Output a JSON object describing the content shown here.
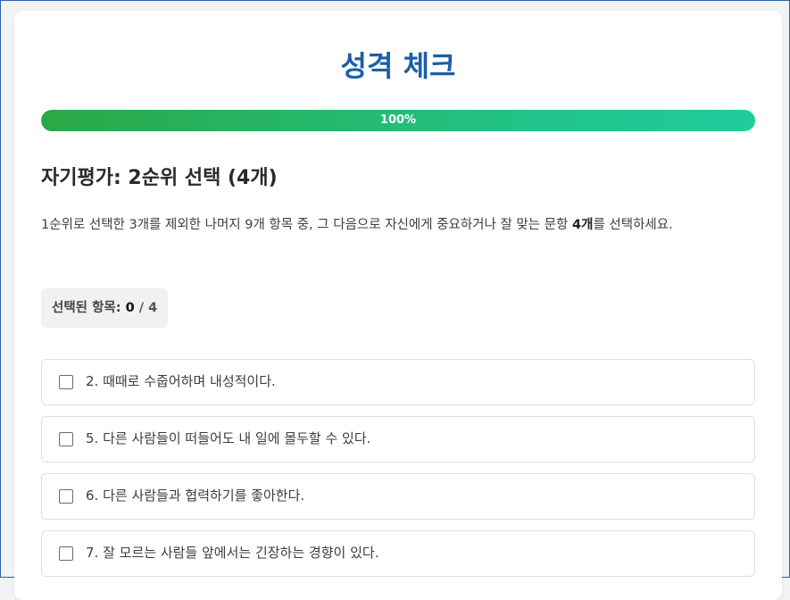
{
  "title": "성격 체크",
  "progress": {
    "percent": 100,
    "label": "100%"
  },
  "section": {
    "title": "자기평가: 2순위 선택 (4개)",
    "instructions_pre": "1순위로 선택한 3개를 제외한 나머지 9개 항목 중, 그 다음으로 자신에게 중요하거나 잘 맞는 문항 ",
    "instructions_bold": "4개",
    "instructions_post": "를 선택하세요."
  },
  "counter": {
    "label": "선택된 항목: ",
    "selected": "0",
    "separator": " / ",
    "total": "4"
  },
  "options": [
    {
      "text": "2. 때때로 수줍어하며 내성적이다.",
      "checked": false
    },
    {
      "text": "5. 다른 사람들이 떠들어도 내 일에 몰두할 수 있다.",
      "checked": false
    },
    {
      "text": "6. 다른 사람들과 협력하기를 좋아한다.",
      "checked": false
    },
    {
      "text": "7. 잘 모르는 사람들 앞에서는 긴장하는 경향이 있다.",
      "checked": false
    }
  ],
  "colors": {
    "title": "#1a5fa8",
    "progress_start": "#2aa845",
    "progress_end": "#1fcc9c"
  }
}
